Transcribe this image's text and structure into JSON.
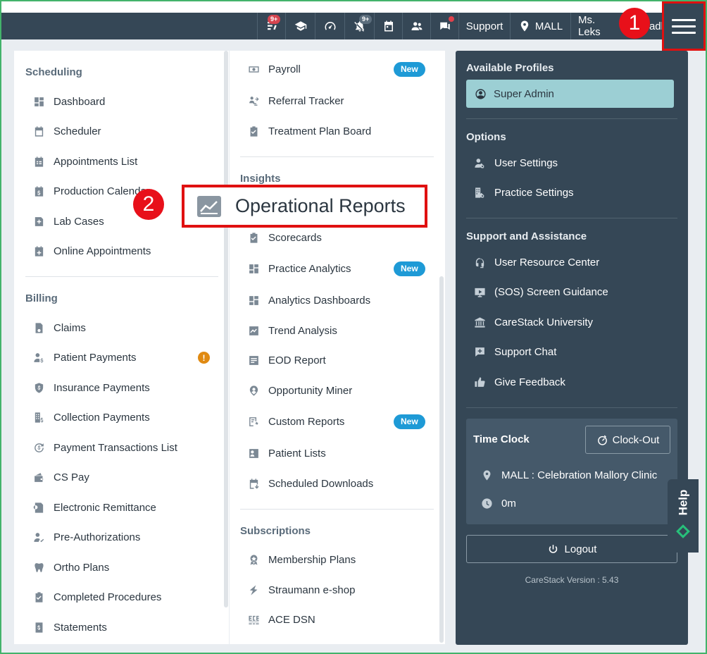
{
  "topbar": {
    "badge_tasks": "9+",
    "badge_notifications": "9+",
    "support_label": "Support",
    "location_label": "MALL",
    "user_label": "Ms. Leks",
    "user_label_tail": "adl"
  },
  "callouts": {
    "one": "1",
    "two": "2"
  },
  "left": {
    "scheduling_title": "Scheduling",
    "scheduling_items": [
      "Dashboard",
      "Scheduler",
      "Appointments List",
      "Production Calendar",
      "Lab Cases",
      "Online Appointments"
    ],
    "billing_title": "Billing",
    "billing_items": [
      "Claims",
      "Patient Payments",
      "Insurance Payments",
      "Collection Payments",
      "Payment Transactions List",
      "CS Pay",
      "Electronic Remittance",
      "Pre-Authorizations",
      "Ortho Plans",
      "Completed Procedures",
      "Statements"
    ],
    "alert_glyph": "!"
  },
  "middle": {
    "top_items": [
      "Payroll",
      "Referral Tracker",
      "Treatment Plan Board"
    ],
    "new_label": "New",
    "insights_title": "Insights",
    "highlighted_item": "Operational Reports",
    "insights_items": [
      "Scorecards",
      "Practice Analytics",
      "Analytics Dashboards",
      "Trend Analysis",
      "EOD Report",
      "Opportunity Miner",
      "Custom Reports",
      "Patient Lists",
      "Scheduled Downloads"
    ],
    "subscriptions_title": "Subscriptions",
    "subscriptions_items": [
      "Membership Plans",
      "Straumann e-shop",
      "ACE DSN"
    ]
  },
  "right": {
    "profiles_title": "Available Profiles",
    "profile_active": "Super Admin",
    "options_title": "Options",
    "options_items": [
      "User Settings",
      "Practice Settings"
    ],
    "support_title": "Support and Assistance",
    "support_items": [
      "User Resource Center",
      "(SOS) Screen Guidance",
      "CareStack University",
      "Support Chat",
      "Give Feedback"
    ],
    "timeclock_title": "Time Clock",
    "clockout_label": "Clock-Out",
    "clinic_label": "MALL : Celebration Mallory Clinic",
    "duration_label": "0m",
    "logout_label": "Logout",
    "version_label": "CareStack Version : 5.43"
  },
  "help_label": "Help",
  "colors": {
    "topbar": "#354756",
    "accent_badge": "#1e9ad6",
    "highlight_border": "#e01010",
    "profile_pill": "#9ccfd4"
  }
}
